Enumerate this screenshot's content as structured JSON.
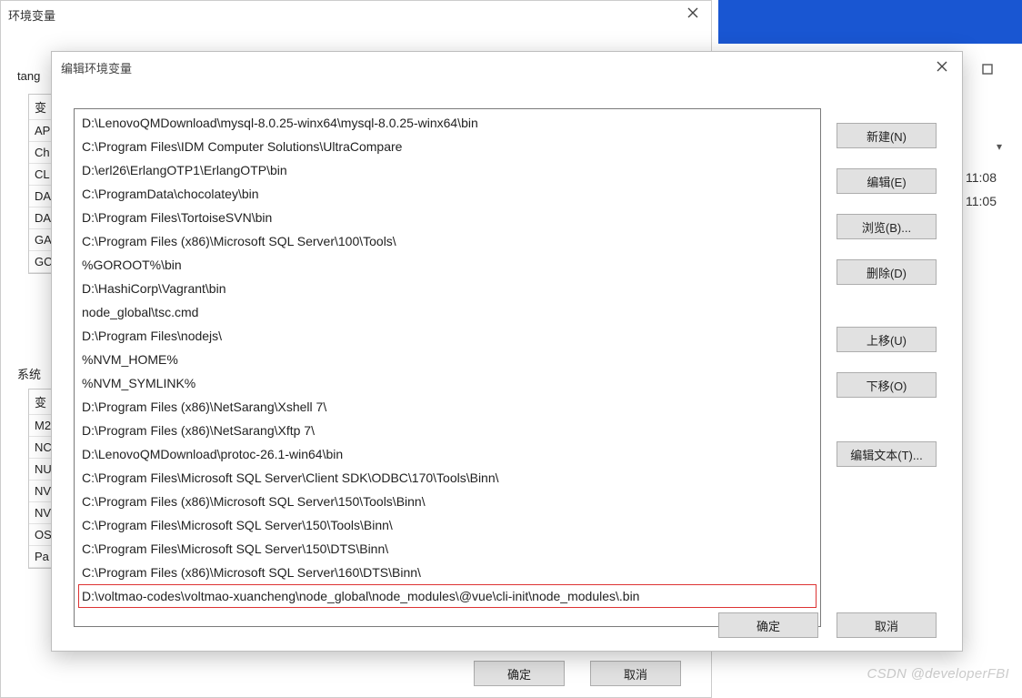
{
  "parent": {
    "title": "环境变量",
    "user_section_label_prefix": "tang",
    "user_vars_header": "变",
    "user_vars": [
      "AP",
      "Ch",
      "CL",
      "DA",
      "DA",
      "GA",
      "GC"
    ],
    "sys_section_label": "系统",
    "sys_vars_header": "变",
    "sys_vars": [
      "M2",
      "NC",
      "NU",
      "NV",
      "NV",
      "OS",
      "Pa"
    ],
    "ok": "确定",
    "cancel": "取消"
  },
  "edit": {
    "title": "编辑环境变量",
    "paths": [
      "D:\\LenovoQMDownload\\mysql-8.0.25-winx64\\mysql-8.0.25-winx64\\bin",
      "C:\\Program Files\\IDM Computer Solutions\\UltraCompare",
      "D:\\erl26\\ErlangOTP1\\ErlangOTP\\bin",
      "C:\\ProgramData\\chocolatey\\bin",
      "D:\\Program Files\\TortoiseSVN\\bin",
      "C:\\Program Files (x86)\\Microsoft SQL Server\\100\\Tools\\",
      "%GOROOT%\\bin",
      "D:\\HashiCorp\\Vagrant\\bin",
      "node_global\\tsc.cmd",
      "D:\\Program Files\\nodejs\\",
      "%NVM_HOME%",
      "%NVM_SYMLINK%",
      "D:\\Program Files (x86)\\NetSarang\\Xshell 7\\",
      "D:\\Program Files (x86)\\NetSarang\\Xftp 7\\",
      "D:\\LenovoQMDownload\\protoc-26.1-win64\\bin",
      "C:\\Program Files\\Microsoft SQL Server\\Client SDK\\ODBC\\170\\Tools\\Binn\\",
      "C:\\Program Files (x86)\\Microsoft SQL Server\\150\\Tools\\Binn\\",
      "C:\\Program Files\\Microsoft SQL Server\\150\\Tools\\Binn\\",
      "C:\\Program Files\\Microsoft SQL Server\\150\\DTS\\Binn\\",
      "C:\\Program Files (x86)\\Microsoft SQL Server\\160\\DTS\\Binn\\",
      "D:\\voltmao-codes\\voltmao-xuancheng\\node_global\\node_modules\\@vue\\cli-init\\node_modules\\.bin"
    ],
    "highlighted_index": 20,
    "buttons": {
      "new_btn": "新建(N)",
      "edit_btn": "编辑(E)",
      "browse": "浏览(B)...",
      "delete_btn": "删除(D)",
      "up": "上移(U)",
      "down": "下移(O)",
      "edit_text": "编辑文本(T)..."
    },
    "ok": "确定",
    "cancel": "取消"
  },
  "right": {
    "time1": "11:08",
    "time2": "11:05"
  },
  "watermark": "CSDN @developerFBI"
}
